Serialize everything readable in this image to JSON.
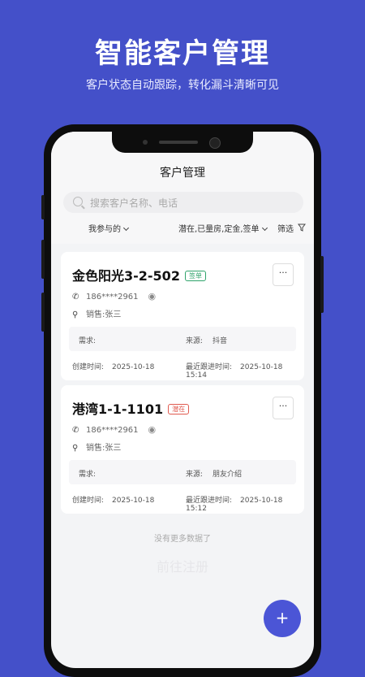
{
  "banner": {
    "title": "智能客户管理",
    "subtitle": "客户状态自动跟踪，转化漏斗清晰可见"
  },
  "app": {
    "title": "客户管理",
    "search_placeholder": "搜索客户名称、电话",
    "filters": {
      "mine": "我参与的",
      "status": "潜在,已量房,定金,签单",
      "filter": "筛选"
    },
    "customers": [
      {
        "name": "金色阳光3-2-502",
        "tag": "签单",
        "tag_color": "#2fa36b",
        "phone": "186****2961",
        "sales": "销售:张三",
        "need_label": "需求:",
        "source_label": "来源:",
        "source": "抖音",
        "created_label": "创建时间:",
        "created": "2025-10-18",
        "follow_label": "最近跟进时间:",
        "follow": "2025-10-18 15:14"
      },
      {
        "name": "港湾1-1-1101",
        "tag": "潜在",
        "tag_color": "#e05a4f",
        "phone": "186****2961",
        "sales": "销售:张三",
        "need_label": "需求:",
        "source_label": "来源:",
        "source": "朋友介绍",
        "created_label": "创建时间:",
        "created": "2025-10-18",
        "follow_label": "最近跟进时间:",
        "follow": "2025-10-18 15:12"
      }
    ],
    "no_more": "没有更多数据了",
    "watermark": "前往注册",
    "fab_label": "+"
  },
  "colors": {
    "background": "#4450c9",
    "accent": "#4b55d6"
  }
}
